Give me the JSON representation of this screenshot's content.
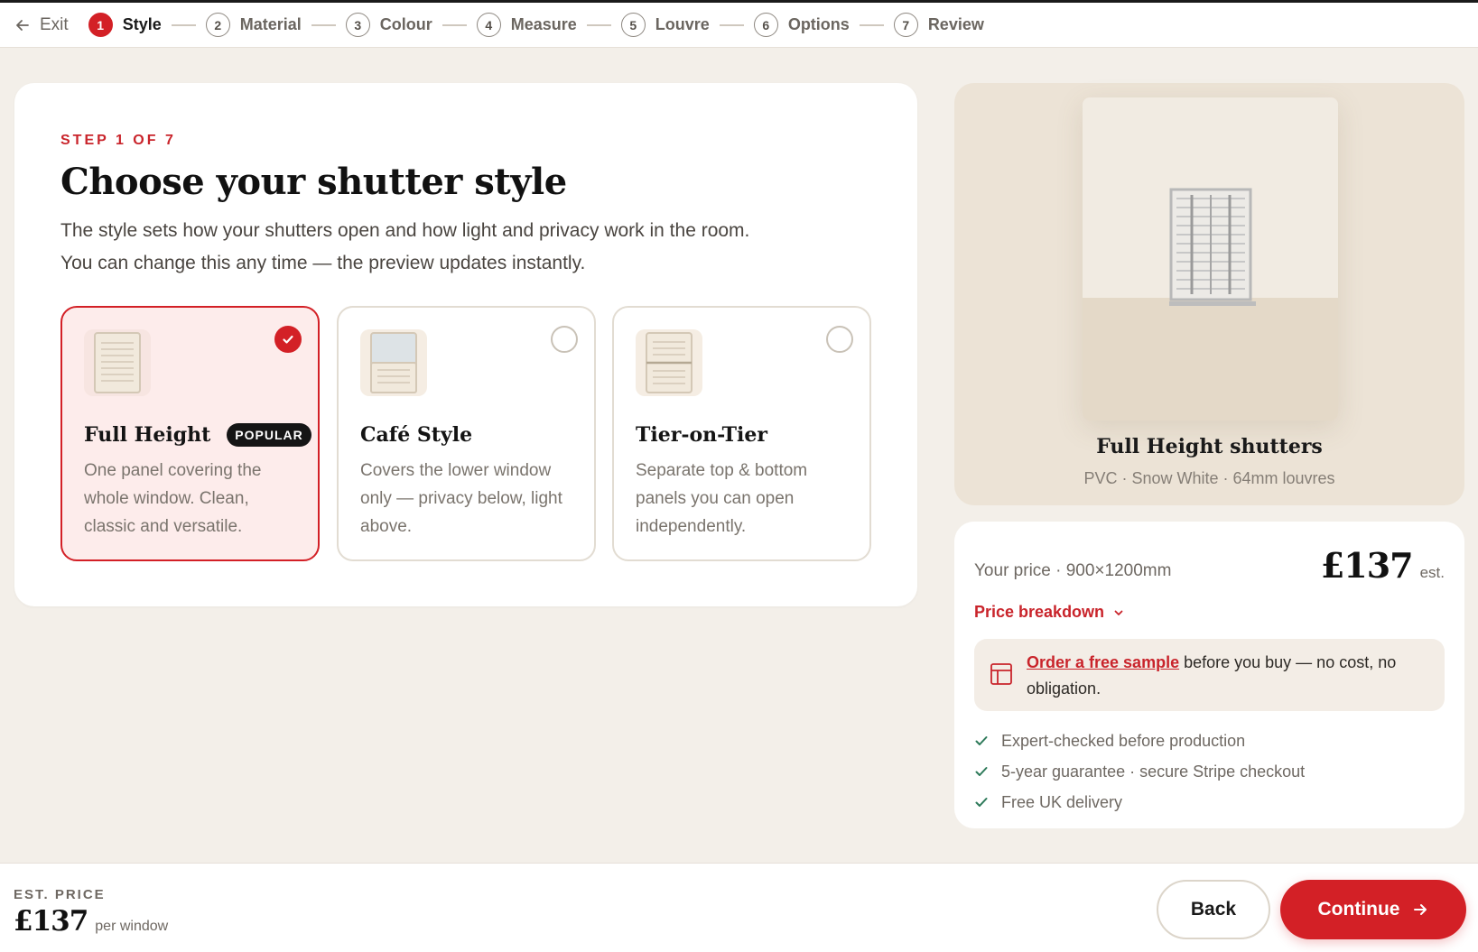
{
  "nav": {
    "exit_label": "Exit",
    "steps": [
      {
        "num": "1",
        "label": "Style",
        "active": true
      },
      {
        "num": "2",
        "label": "Material"
      },
      {
        "num": "3",
        "label": "Colour"
      },
      {
        "num": "4",
        "label": "Measure"
      },
      {
        "num": "5",
        "label": "Louvre"
      },
      {
        "num": "6",
        "label": "Options"
      },
      {
        "num": "7",
        "label": "Review"
      }
    ]
  },
  "main": {
    "eyebrow": "STEP 1 OF 7",
    "title": "Choose your shutter style",
    "subtitle": "The style sets how your shutters open and how light and privacy work in the room. You can change this any time — the preview updates instantly.",
    "options": [
      {
        "title": "Full Height",
        "badge": "POPULAR",
        "desc": "One panel covering the whole window. Clean, classic and versatile.",
        "selected": true
      },
      {
        "title": "Café Style",
        "desc": "Covers the lower window only — privacy below, light above.",
        "selected": false
      },
      {
        "title": "Tier-on-Tier",
        "desc": "Separate top & bottom panels you can open independently.",
        "selected": false
      }
    ]
  },
  "preview": {
    "title": "Full Height shutters",
    "subtitle": "PVC · Snow White · 64mm louvres"
  },
  "price_card": {
    "label": "Your price · 900×1200mm",
    "amount": "£137",
    "est": "est.",
    "breakdown": "Price breakdown",
    "sample_link": "Order a free sample",
    "sample_rest": " before you buy — no cost, no obligation.",
    "benefits": [
      "Expert-checked before production",
      "5-year guarantee · secure Stripe checkout",
      "Free UK delivery"
    ]
  },
  "footer": {
    "label": "EST. PRICE",
    "amount": "£137",
    "per": "per window",
    "back": "Back",
    "continue": "Continue"
  },
  "colors": {
    "accent": "#d32026",
    "background": "#f3efe9"
  }
}
